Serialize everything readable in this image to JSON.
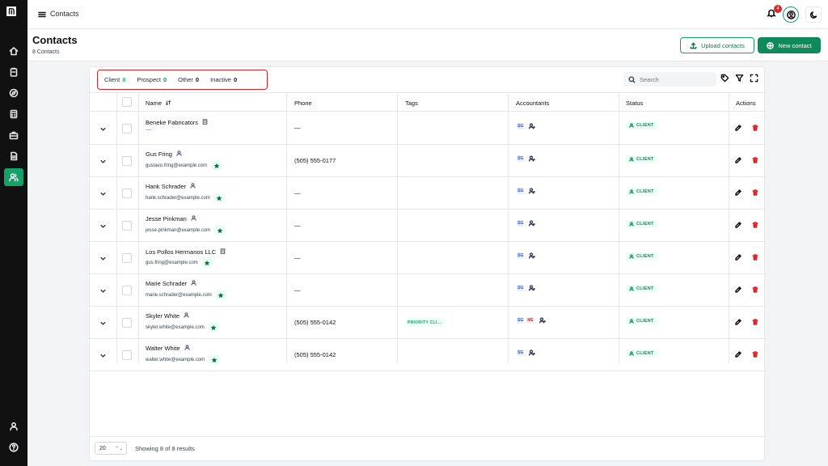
{
  "app": {
    "breadcrumb": "Contacts",
    "notification_count": "4"
  },
  "header": {
    "title": "Contacts",
    "subtitle": "8 Contacts",
    "upload_label": "Upload contacts",
    "new_label": "New contact"
  },
  "filters": [
    {
      "label": "Client",
      "count": "8"
    },
    {
      "label": "Prospect",
      "count": "0"
    },
    {
      "label": "Other",
      "count": "0"
    },
    {
      "label": "Inactive",
      "count": "0"
    }
  ],
  "search": {
    "placeholder": "Search"
  },
  "columns": {
    "name": "Name",
    "phone": "Phone",
    "tags": "Tags",
    "accountants": "Accountants",
    "status": "Status",
    "actions": "Actions"
  },
  "rows": [
    {
      "name": "Beneke Fabricators",
      "email": "—",
      "phone": "—",
      "tag": "",
      "accountants": [
        "SG"
      ],
      "status": "CLIENT"
    },
    {
      "name": "Gus Fring",
      "email": "gustavo.fring@example.com",
      "phone": "(505) 555-0177",
      "tag": "",
      "accountants": [
        "SG"
      ],
      "status": "CLIENT"
    },
    {
      "name": "Hank Schrader",
      "email": "hank.schrader@example.com",
      "phone": "—",
      "tag": "",
      "accountants": [
        "SG"
      ],
      "status": "CLIENT"
    },
    {
      "name": "Jesse Pinkman",
      "email": "jesse.pinkman@example.com",
      "phone": "—",
      "tag": "",
      "accountants": [
        "SG"
      ],
      "status": "CLIENT"
    },
    {
      "name": "Los Pollos Hermanos LLC",
      "email": "gus.fring@example.com",
      "phone": "—",
      "tag": "",
      "accountants": [
        "SG"
      ],
      "status": "CLIENT"
    },
    {
      "name": "Marie Schrader",
      "email": "marie.schrader@example.com",
      "phone": "—",
      "tag": "",
      "accountants": [
        "SG"
      ],
      "status": "CLIENT"
    },
    {
      "name": "Skyler White",
      "email": "skyler.white@example.com",
      "phone": "(505) 555-0142",
      "tag": "PRIORITY CLI...",
      "accountants": [
        "SG",
        "ME"
      ],
      "status": "CLIENT"
    },
    {
      "name": "Walter White",
      "email": "walter.white@example.com",
      "phone": "(505) 555-0142",
      "tag": "",
      "accountants": [
        "SG"
      ],
      "status": "CLIENT"
    }
  ],
  "footer": {
    "page_size": "20",
    "results": "Showing 8 of 8 results"
  },
  "colors": {
    "accent": "#0e8a5b",
    "rail": "#111111",
    "danger": "#dc2626"
  }
}
